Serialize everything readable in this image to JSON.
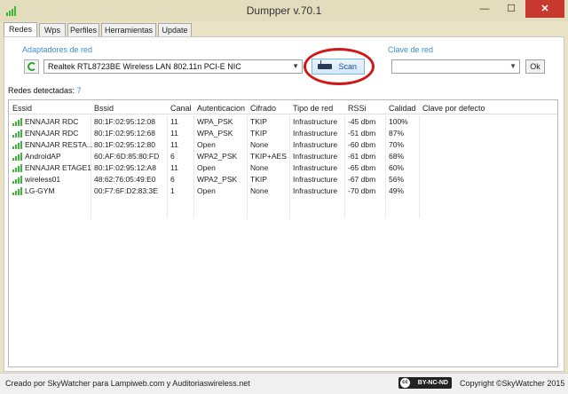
{
  "window": {
    "title": "Dumpper v.70.1",
    "min": "—",
    "max": "☐",
    "close": "✕"
  },
  "tabs": [
    "Redes",
    "Wps",
    "Perfiles",
    "Herramientas",
    "Update"
  ],
  "adapters": {
    "label": "Adaptadores de red",
    "selected": "Realtek RTL8723BE Wireless LAN 802.11n PCI-E NIC",
    "scan_label": "Scan"
  },
  "clave": {
    "label": "Clave de red",
    "value": "",
    "ok_label": "Ok"
  },
  "redes": {
    "label": "Redes detectadas:",
    "count": "7"
  },
  "table": {
    "headers": [
      "Essid",
      "Bssid",
      "Canal",
      "Autenticacion",
      "Cifrado",
      "Tipo de red",
      "RSSi",
      "Calidad",
      "Clave por defecto"
    ],
    "rows": [
      [
        "ENNAJAR RDC",
        "80:1F:02:95:12:08",
        "11",
        "WPA_PSK",
        "TKIP",
        "Infrastructure",
        "-45 dbm",
        "100%",
        ""
      ],
      [
        "ENNAJAR RDC",
        "80:1F:02:95:12:68",
        "11",
        "WPA_PSK",
        "TKIP",
        "Infrastructure",
        "-51 dbm",
        "87%",
        ""
      ],
      [
        "ENNAJAR RESTA...",
        "80:1F:02:95:12:80",
        "11",
        "Open",
        "None",
        "Infrastructure",
        "-60 dbm",
        "70%",
        ""
      ],
      [
        "AndroidAP",
        "60:AF:6D:85:80:FD",
        "6",
        "WPA2_PSK",
        "TKIP+AES",
        "Infrastructure",
        "-61 dbm",
        "68%",
        ""
      ],
      [
        "ENNAJAR ETAGE1",
        "80:1F:02:95:12:A8",
        "11",
        "Open",
        "None",
        "Infrastructure",
        "-65 dbm",
        "60%",
        ""
      ],
      [
        "wireless01",
        "48:62:76:05:49:E0",
        "6",
        "WPA2_PSK",
        "TKIP",
        "Infrastructure",
        "-67 dbm",
        "56%",
        ""
      ],
      [
        "LG-GYM",
        "00:F7:6F:D2:83:3E",
        "1",
        "Open",
        "None",
        "Infrastructure",
        "-70 dbm",
        "49%",
        ""
      ]
    ]
  },
  "status": {
    "credit": "Creado por SkyWatcher para Lampiweb.com y Auditoriaswireless.net",
    "license_badge": "BY-NC-ND",
    "license_cc": "cc",
    "copyright": "Copyright ©SkyWatcher 2015"
  },
  "colors": {
    "accent_blue": "#3d8fd6",
    "signal_green": "#3cb63c",
    "highlight_red": "#d01818",
    "close_red": "#c7392e"
  }
}
